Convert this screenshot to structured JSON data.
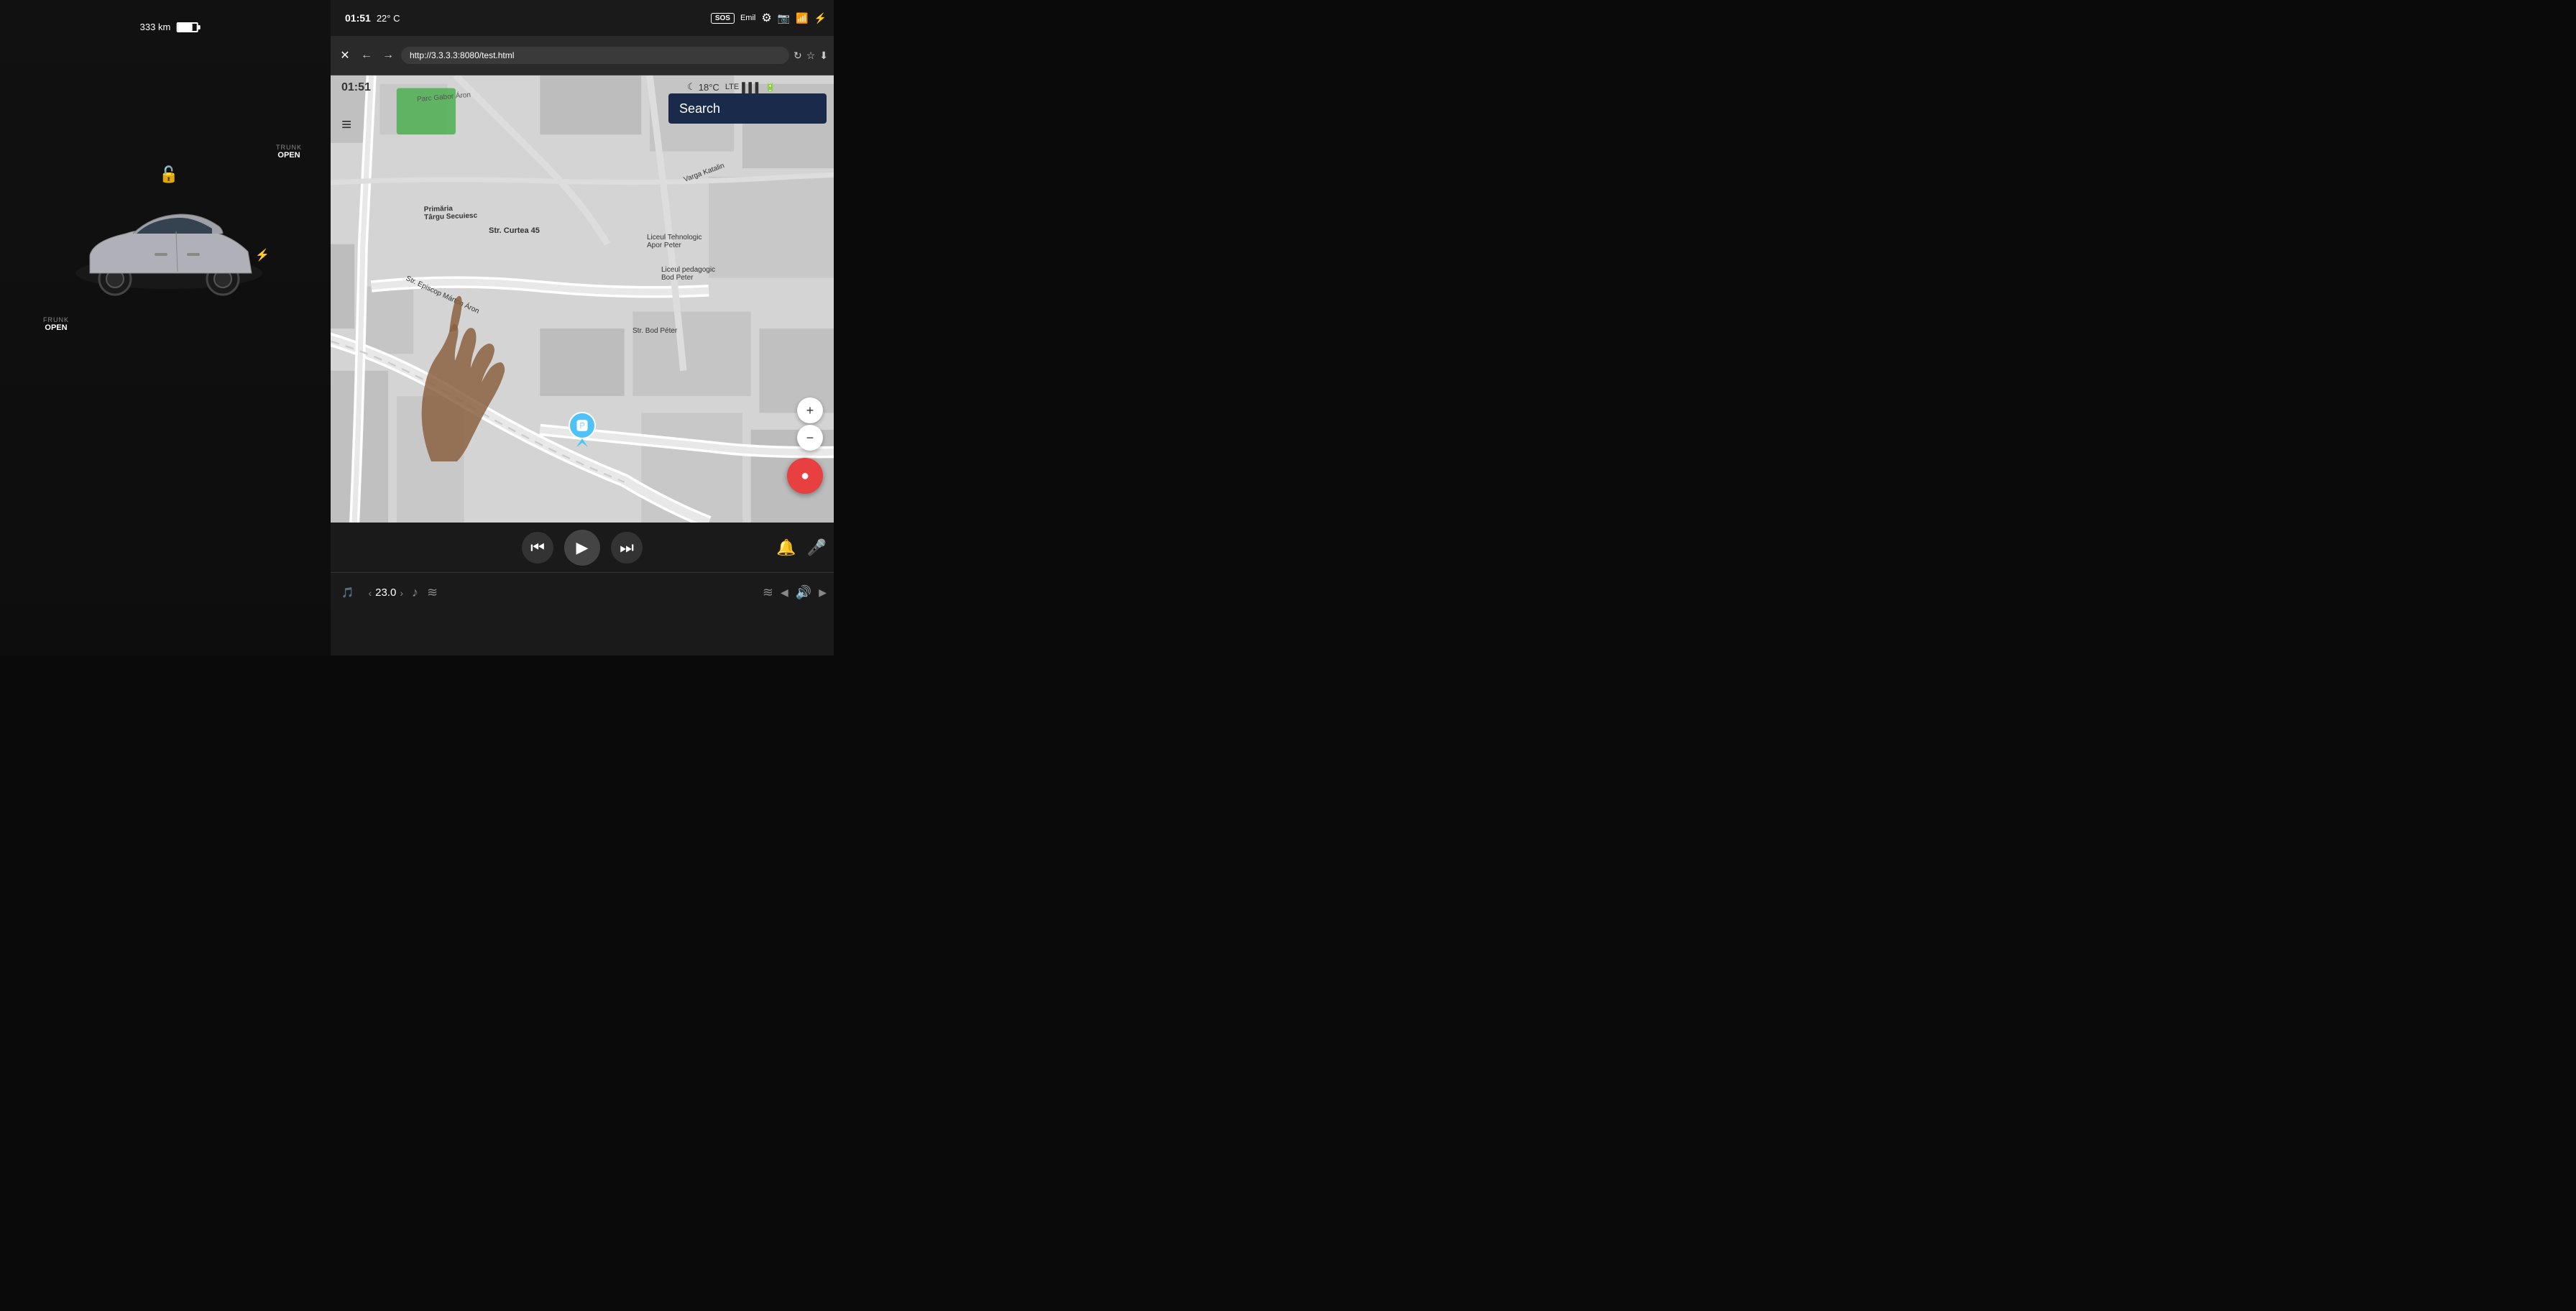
{
  "dashboard": {
    "battery_km": "333 km",
    "trunk_label": "TRUNK",
    "trunk_status": "OPEN",
    "frunk_label": "FRUNK",
    "frunk_status": "OPEN"
  },
  "tablet": {
    "statusbar": {
      "time": "01:51",
      "temp": "22° C",
      "sos": "SOS",
      "user": "Emil",
      "signal_text": "LTE"
    },
    "browser": {
      "url": "http://3.3.3.3:8080/test.html",
      "close_label": "✕",
      "back_label": "←",
      "forward_label": "→",
      "refresh_label": "↻"
    },
    "map": {
      "time_overlay": "01:51",
      "signal_overlay": "18°C",
      "search_placeholder": "Search",
      "menu_icon": "≡",
      "streets": [
        "Str. Curtea 45",
        "Str. Episcop Márton Áron",
        "Str. Bod Péter",
        "Parc Gabor Áron",
        "Primăria Târgu Secuiesc",
        "Liceul Tehnologic Apor Peter",
        "Liceul pedagogic Bod Peter",
        "Varga Katalin"
      ],
      "zoom_plus": "+",
      "zoom_minus": "−",
      "location_icon": "◉"
    },
    "media": {
      "prev_label": "⏮",
      "play_label": "▶",
      "next_label": "⏭"
    },
    "climate": {
      "temp_value": "23.0",
      "temp_unit": "",
      "left_arrow": "‹",
      "right_arrow": "›"
    },
    "bottom_right": {
      "climate_icon": "≋",
      "vol_down": "◀",
      "vol_icon": "🔊",
      "vol_right": "▶"
    }
  }
}
